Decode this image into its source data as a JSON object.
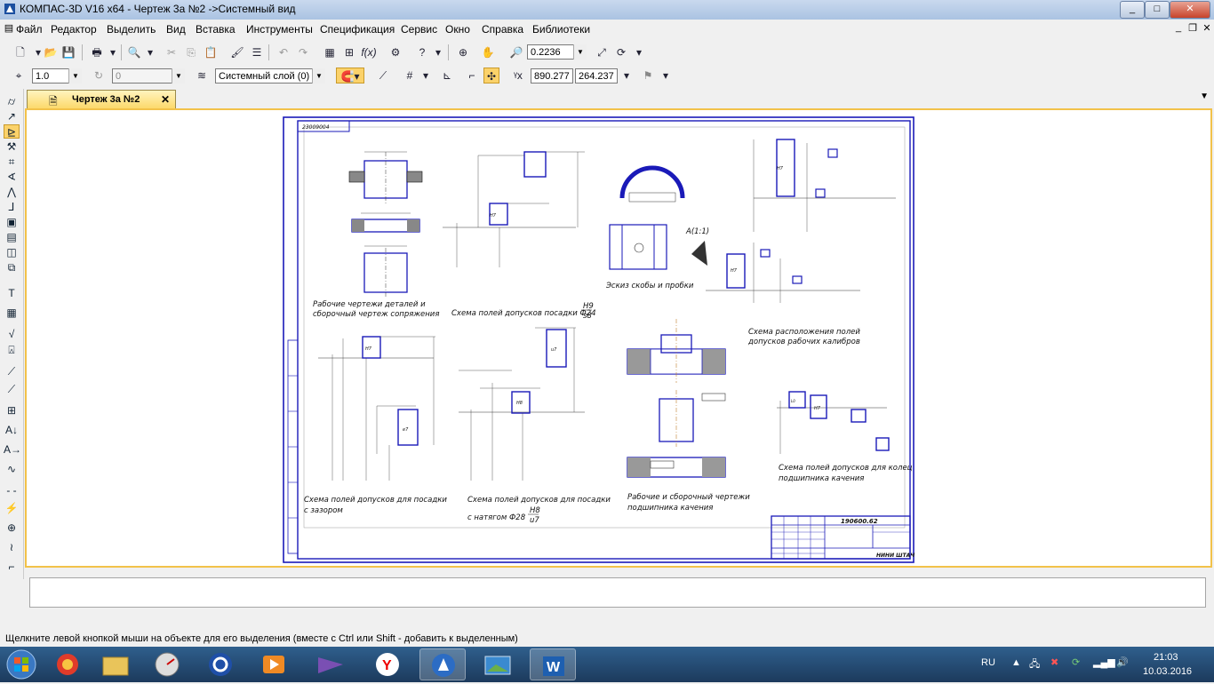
{
  "window": {
    "title": "КОМПАС-3D V16  x64 - Чертеж 3а №2 ->Системный вид",
    "min": "_",
    "max": "□",
    "close": "✕"
  },
  "menu": [
    "Файл",
    "Редактор",
    "Выделить",
    "Вид",
    "Вставка",
    "Инструменты",
    "Спецификация",
    "Сервис",
    "Окно",
    "Справка",
    "Библиотеки"
  ],
  "toolbar1": {
    "zoom": "0.2236"
  },
  "toolbar2": {
    "line_step": "1.0",
    "angle": "0",
    "layer": "Системный слой (0)",
    "coord_x": "890.277",
    "coord_y": "264.237"
  },
  "tab": {
    "label": "Чертеж 3а №2",
    "close": "✕"
  },
  "drawing": {
    "stamp": "23009004",
    "doc_code": "190600.62",
    "org": "НИНИ ШТАЧ",
    "captions": {
      "c1_line1": "Рабочие чертежи деталей и",
      "c1_line2": "сборочный чертеж сопряжения",
      "c2": "Схема полей допусков посадки Ф24",
      "c2_num": "H9",
      "c2_den": "s8",
      "c3": "Эскиз скобы и пробки",
      "c3_label": "A(1:1)",
      "c4_line1": "Схема расположения полей",
      "c4_line2": "допусков рабочих калибров",
      "c5_line1": "Схема полей допусков для посадки",
      "c5_line2": "с зазором",
      "c6_line1": "Схема полей допусков для посадки",
      "c6_line2": "с натягом Ф28",
      "c6_num": "H8",
      "c6_den": "u7",
      "c7_line1": "Рабочие и сборочный чертежи",
      "c7_line2": "подшипника качения",
      "c8_line1": "Схема полей допусков для колец",
      "c8_line2": "подшипника качения"
    },
    "zone_labels": {
      "h7_a": "H7",
      "h7_b": "H7",
      "e7": "e7",
      "h8": "H8",
      "u7": "u7",
      "h7_c": "H7",
      "l0": "L0",
      "h7_d": "H7",
      "h7_e": "H7"
    }
  },
  "status_text": "Щелкните левой кнопкой мыши на объекте для его выделения (вместе с Ctrl или Shift - добавить к выделенным)",
  "tray": {
    "lang": "RU",
    "time": "21:03",
    "date": "10.03.2016"
  }
}
